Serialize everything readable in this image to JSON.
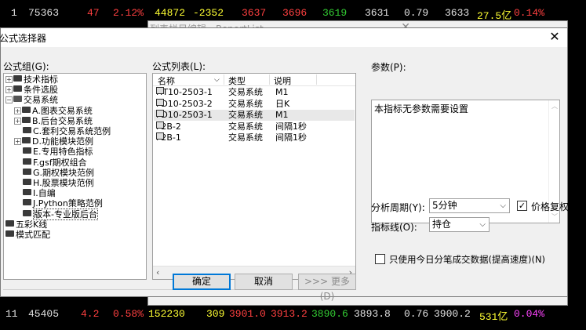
{
  "ticker_top": {
    "n": "1",
    "code": "75363",
    "a": "47",
    "pct": "2.12%",
    "vol": "44872",
    "chg": "-2352",
    "p1": "3637",
    "p2": "3696",
    "p3": "3619",
    "p4": "3631",
    "r": "0.79",
    "p5": "3633",
    "amt": "27.5亿",
    "rate": "0.14%"
  },
  "ticker_bottom": {
    "n": "11",
    "code": "45405",
    "a": "4.2",
    "pct": "0.58%",
    "vol": "152230",
    "chg": "309",
    "p1": "3901.0",
    "p2": "3913.2",
    "p3": "3890.6",
    "p4": "3893.8",
    "r": "0.76",
    "p5": "3900.2",
    "amt": "531亿",
    "rate": "0.04%"
  },
  "bg_window": {
    "title": "列表栏目编辑 - ReportList",
    "close": "✕"
  },
  "dialog": {
    "title": "公式选择器",
    "close": "✕",
    "group_label": "公式组(G):",
    "list_label": "公式列表(L):",
    "params_label": "参数(P):",
    "params_text": "本指标无参数需要设置",
    "tree": [
      {
        "label": "技术指标",
        "level": 0,
        "expander": "+"
      },
      {
        "label": "条件选股",
        "level": 0,
        "expander": "+"
      },
      {
        "label": "交易系统",
        "level": 0,
        "expander": "−",
        "open": true
      },
      {
        "label": "A.图表交易系统",
        "level": 1,
        "expander": "+"
      },
      {
        "label": "B.后台交易系统",
        "level": 1,
        "expander": "+"
      },
      {
        "label": "C.套利交易系统范例",
        "level": 1,
        "expander": ""
      },
      {
        "label": "D.功能模块范例",
        "level": 1,
        "expander": "+"
      },
      {
        "label": "E.专用特色指标",
        "level": 1,
        "expander": ""
      },
      {
        "label": "F.gsf期权组合",
        "level": 1,
        "expander": ""
      },
      {
        "label": "G.期权模块范例",
        "level": 1,
        "expander": ""
      },
      {
        "label": "H.股票模块范例",
        "level": 1,
        "expander": ""
      },
      {
        "label": "I.自编",
        "level": 1,
        "expander": ""
      },
      {
        "label": "J.Python策略范例",
        "level": 1,
        "expander": ""
      },
      {
        "label": "版本-专业版后台",
        "level": 1,
        "expander": "",
        "selected": true
      },
      {
        "label": "五彩K线",
        "level": 0,
        "expander": ""
      },
      {
        "label": "模式匹配",
        "level": 0,
        "expander": ""
      }
    ],
    "list_headers": {
      "name": "名称",
      "type": "类型",
      "desc": "说明"
    },
    "list_rows": [
      {
        "name": "HT10-2503-1",
        "type": "交易系统",
        "desc": "M1"
      },
      {
        "name": "FD10-2503-2",
        "type": "交易系统",
        "desc": "日K"
      },
      {
        "name": "FD10-2503-1",
        "type": "交易系统",
        "desc": "M1",
        "highlight": true
      },
      {
        "name": "F2B-2",
        "type": "交易系统",
        "desc": "间隔1秒"
      },
      {
        "name": "F2B-1",
        "type": "交易系统",
        "desc": "间隔1秒"
      }
    ],
    "period_label": "分析周期(Y):",
    "period_value": "5分钟",
    "price_adjust_label": "价格复权",
    "price_adjust_checked": "✓",
    "indicator_label": "指标线(O):",
    "indicator_value": "持仓",
    "today_only_label": "只使用今日分笔成交数据(提高速度)(N)",
    "ok": "确定",
    "cancel": "取消",
    "more": ">>> 更多(D)"
  }
}
